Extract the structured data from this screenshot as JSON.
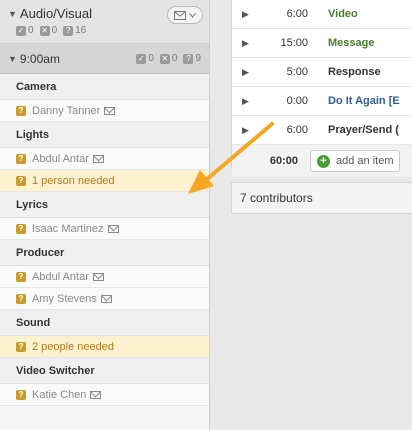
{
  "sidebar": {
    "section_title": "Audio/Visual",
    "counts": {
      "confirmed": "0",
      "declined": "0",
      "unconfirmed": "16"
    },
    "time": {
      "label": "9:00am",
      "counts": {
        "confirmed": "0",
        "declined": "0",
        "unconfirmed": "9"
      }
    },
    "roles": [
      {
        "name": "Camera",
        "people": [
          {
            "name": "Danny Tanner"
          }
        ]
      },
      {
        "name": "Lights",
        "people": [
          {
            "name": "Abdul Antar"
          }
        ],
        "needed": "1 person needed"
      },
      {
        "name": "Lyrics",
        "people": [
          {
            "name": "Isaac Martinez"
          }
        ]
      },
      {
        "name": "Producer",
        "people": [
          {
            "name": "Abdul Antar"
          },
          {
            "name": "Amy Stevens"
          }
        ]
      },
      {
        "name": "Sound",
        "needed": "2 people needed"
      },
      {
        "name": "Video Switcher",
        "people": [
          {
            "name": "Katie Chen"
          }
        ]
      }
    ],
    "status_glyphs": {
      "confirmed": "✓",
      "declined": "✕",
      "unconfirmed": "?"
    }
  },
  "plan": {
    "items": [
      {
        "length": "6:00",
        "title": "Video",
        "color": "green"
      },
      {
        "length": "15:00",
        "title": "Message",
        "color": "green"
      },
      {
        "length": "5:00",
        "title": "Response",
        "color": "dark"
      },
      {
        "length": "0:00",
        "title": "Do It Again [E",
        "color": "blue"
      },
      {
        "length": "6:00",
        "title": "Prayer/Send (",
        "color": "dark"
      }
    ],
    "total": "60:00",
    "add_label": "add an item"
  },
  "contributors": "7 contributors",
  "colors": {
    "arrow": "#f5a623",
    "needed_bg": "#fdf2d0",
    "accent_green": "#4a9a3a"
  }
}
